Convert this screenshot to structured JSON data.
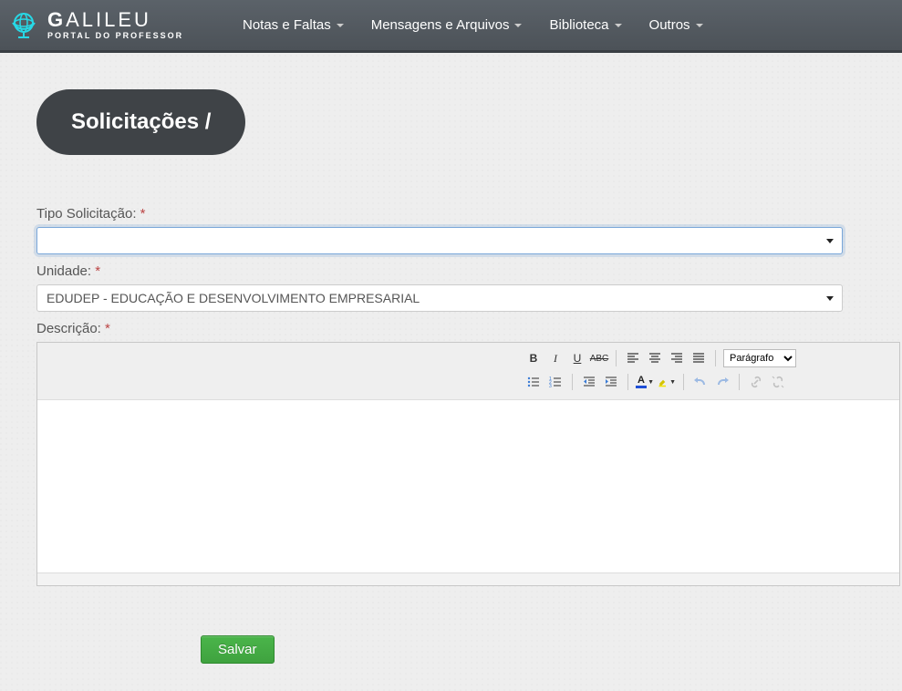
{
  "brand": {
    "name": "GALILEU",
    "subtitle": "PORTAL DO PROFESSOR"
  },
  "nav": {
    "items": [
      {
        "label": "Notas e Faltas"
      },
      {
        "label": "Mensagens e Arquivos"
      },
      {
        "label": "Biblioteca"
      },
      {
        "label": "Outros"
      }
    ]
  },
  "page": {
    "title": "Solicitações /"
  },
  "form": {
    "tipo_label": "Tipo Solicitação:",
    "tipo_value": "",
    "unidade_label": "Unidade:",
    "unidade_value": "EDUDEP - EDUCAÇÃO E DESENVOLVIMENTO EMPRESARIAL",
    "descricao_label": "Descrição:",
    "required_mark": "*",
    "save_label": "Salvar"
  },
  "editor": {
    "format_select": "Parágrafo"
  }
}
